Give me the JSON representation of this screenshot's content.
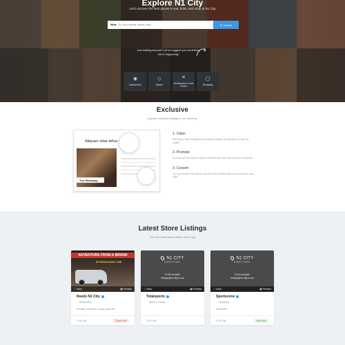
{
  "hero": {
    "title": "Explore N1 City",
    "subtitle": "Let's uncover the best places to eat, drink, and shop at N1 City",
    "search_label": "What",
    "search_placeholder": "Ex: food, service, barber, hotel",
    "search_button": "Search",
    "note": "Just looking around? Let us suggest you something hot & happening!",
    "categories": [
      {
        "label": "Automotive",
        "icon": "car-icon"
      },
      {
        "label": "Banks",
        "icon": "bank-icon"
      },
      {
        "label": "Restaurant & Fast Foods",
        "icon": "cutlery-icon"
      },
      {
        "label": "Shopping",
        "icon": "shopping-bag-icon"
      }
    ]
  },
  "exclusive": {
    "title": "Exclusive",
    "subtitle": "popular exclusive listings in our directory",
    "mock_headline": "Aliquam vitae tellus nunc",
    "mock_tag": "The Hideaway",
    "steps": [
      {
        "title": "1- Claim",
        "text": "Best way to start managing your business listing is by claiming it so you can update."
      },
      {
        "title": "2- Promote",
        "text": "Promote your business to target customers who need your services or products."
      },
      {
        "title": "3- Convert",
        "text": "Turn your visitors into paying customers with exciting offers and services on your page."
      }
    ]
  },
  "latest": {
    "title": "Latest Store Listings",
    "subtitle": "Find the latest stores listed at N1 City",
    "cards": [
      {
        "name": "Reeds N1 City",
        "category": "Automotive",
        "tags": "car sales, car service, luxury, used cars",
        "location": "N1 City",
        "status": "Closed Now",
        "status_kind": "closed",
        "save": "Save",
        "preview": "Preview",
        "banner": "ADVENTURE FROM A BRAND",
        "banner_sub": "INTRODUCING THE"
      },
      {
        "name": "Totalsports",
        "category": "Sport & Leisure",
        "tags": "",
        "location": "N1 City",
        "status": "",
        "status_kind": "",
        "save": "Save",
        "preview": "Preview",
        "logo_main": "N1 CITY",
        "logo_sub": "DIRECTORY",
        "claim_line1": "To list contact:",
        "claim_line2": "listings@n1city.co.za"
      },
      {
        "name": "Sportscene",
        "category": "Shopping",
        "tags": "Sportscene",
        "location": "N1 City",
        "status": "Open Now",
        "status_kind": "open",
        "save": "Save",
        "preview": "Preview",
        "logo_main": "N1 CITY",
        "logo_sub": "DIRECTORY",
        "claim_line1": "To list contact:",
        "claim_line2": "listings@n1city.co.za"
      }
    ]
  }
}
